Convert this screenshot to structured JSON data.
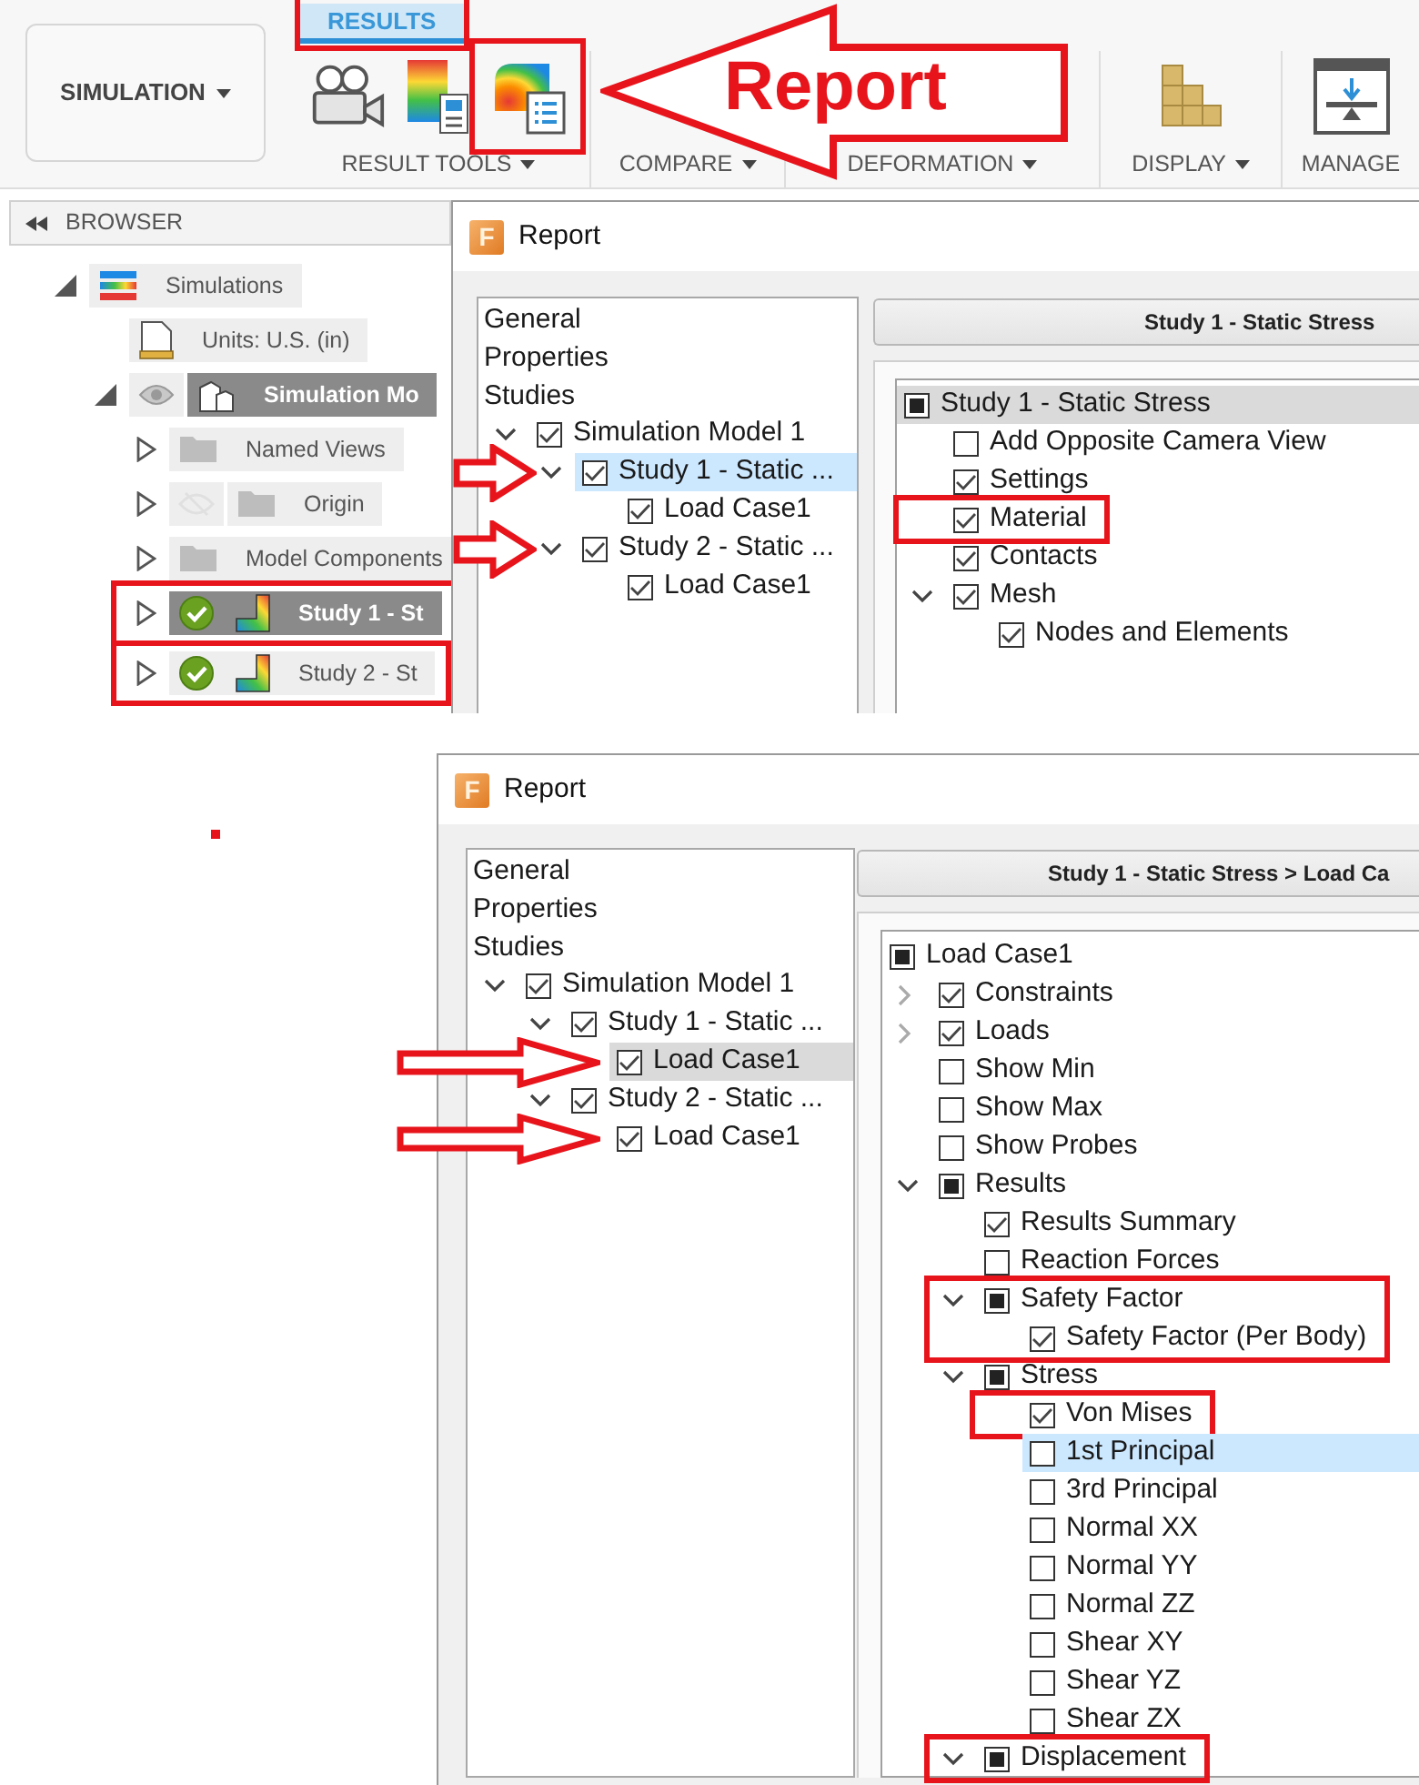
{
  "toolbar": {
    "workspace": {
      "label": "SIMULATION",
      "menu": true
    },
    "tabs": [
      {
        "label": "RESULTS",
        "selected": true,
        "outlined": true
      }
    ],
    "groups": [
      {
        "label": "RESULT TOOLS",
        "menu": true,
        "tools": [
          {
            "kind": "animate"
          },
          {
            "kind": "legend"
          },
          {
            "kind": "report",
            "outlined": true
          }
        ]
      },
      {
        "label": "COMPARE",
        "menu": true
      },
      {
        "label": "DEFORMATION",
        "menu": true
      },
      {
        "label": "DISPLAY",
        "menu": true,
        "tools": [
          {
            "kind": "display"
          }
        ]
      },
      {
        "label": "MANAGE",
        "tools": [
          {
            "kind": "manage"
          }
        ]
      }
    ]
  },
  "callout": {
    "text": "Report"
  },
  "browser": {
    "title": "BROWSER",
    "items": [
      {
        "kind": "simulations",
        "label": "Simulations",
        "expanded": true,
        "selected": false,
        "children": [
          {
            "kind": "units",
            "label": "Units: U.S. (in)",
            "selected": false
          },
          {
            "kind": "model",
            "label": "Simulation Mo",
            "expanded": true,
            "visible": true,
            "selected": true,
            "children": [
              {
                "kind": "folder",
                "label": "Named Views",
                "expanded": false,
                "selected": false
              },
              {
                "kind": "folder",
                "label": "Origin",
                "expanded": false,
                "visible": false,
                "selected": false
              },
              {
                "kind": "folder",
                "label": "Model Components",
                "expanded": false,
                "selected": false
              },
              {
                "kind": "study",
                "label": "Study 1 - St",
                "expanded": false,
                "solved": true,
                "selected": true,
                "outlined": true
              },
              {
                "kind": "study",
                "label": "Study 2 - St",
                "expanded": false,
                "solved": true,
                "selected": false,
                "outlined": true
              }
            ]
          }
        ]
      }
    ]
  },
  "report_windows": [
    {
      "title": "Report",
      "logo": "F",
      "studies_focused": true,
      "sections": [
        {
          "label": "General"
        },
        {
          "label": "Properties"
        },
        {
          "label": "Studies"
        }
      ],
      "study_tree": [
        {
          "label": "Simulation Model 1",
          "checked": true,
          "expanded": true,
          "selected": false,
          "children": [
            {
              "label": "Study 1 - Static ...",
              "checked": true,
              "expanded": true,
              "selected": true,
              "pointer": true,
              "children": [
                {
                  "label": "Load Case1",
                  "checked": true,
                  "selected": false
                }
              ]
            },
            {
              "label": "Study 2 - Static ...",
              "checked": true,
              "expanded": true,
              "selected": false,
              "pointer": true,
              "children": [
                {
                  "label": "Load Case1",
                  "checked": true,
                  "selected": false
                }
              ]
            }
          ]
        }
      ],
      "breadcrumb": "Study 1 - Static Stress",
      "options": [
        {
          "label": "Study 1 - Static Stress",
          "checked": false,
          "partial": true,
          "selected": true,
          "children": [
            {
              "label": "Add Opposite Camera View",
              "checked": false,
              "selected": false
            },
            {
              "label": "Settings",
              "checked": true,
              "selected": false
            },
            {
              "label": "Material",
              "checked": true,
              "selected": false,
              "outlined": true
            },
            {
              "label": "Contacts",
              "checked": true,
              "selected": false
            },
            {
              "label": "Mesh",
              "checked": true,
              "expanded": true,
              "selected": false,
              "children": [
                {
                  "label": "Nodes and Elements",
                  "checked": true,
                  "selected": false
                }
              ]
            }
          ]
        }
      ]
    },
    {
      "title": "Report",
      "logo": "F",
      "studies_focused": false,
      "sections": [
        {
          "label": "General"
        },
        {
          "label": "Properties"
        },
        {
          "label": "Studies"
        }
      ],
      "study_tree": [
        {
          "label": "Simulation Model 1",
          "checked": true,
          "expanded": true,
          "selected": false,
          "children": [
            {
              "label": "Study 1 - Static ...",
              "checked": true,
              "expanded": true,
              "selected": false,
              "children": [
                {
                  "label": "Load Case1",
                  "checked": true,
                  "selected": true,
                  "pointer": true
                }
              ]
            },
            {
              "label": "Study 2 - Static ...",
              "checked": true,
              "expanded": true,
              "selected": false,
              "children": [
                {
                  "label": "Load Case1",
                  "checked": true,
                  "selected": false,
                  "pointer": true
                }
              ]
            }
          ]
        }
      ],
      "breadcrumb": "Study 1 - Static Stress > Load Ca",
      "options": [
        {
          "label": "Load Case1",
          "checked": false,
          "partial": true,
          "selected": false,
          "children": [
            {
              "label": "Constraints",
              "checked": true,
              "expanded": false,
              "selected": false
            },
            {
              "label": "Loads",
              "checked": true,
              "expanded": false,
              "selected": false
            },
            {
              "label": "Show Min",
              "checked": false,
              "selected": false
            },
            {
              "label": "Show Max",
              "checked": false,
              "selected": false
            },
            {
              "label": "Show Probes",
              "checked": false,
              "selected": false
            },
            {
              "label": "Results",
              "checked": false,
              "partial": true,
              "expanded": true,
              "selected": false,
              "children": [
                {
                  "label": "Results Summary",
                  "checked": true,
                  "selected": false
                },
                {
                  "label": "Reaction Forces",
                  "checked": false,
                  "selected": false
                },
                {
                  "label": "Safety Factor",
                  "checked": false,
                  "partial": true,
                  "expanded": true,
                  "selected": false,
                  "outlined": true,
                  "children": [
                    {
                      "label": "Safety Factor (Per Body)",
                      "checked": true,
                      "selected": false
                    }
                  ]
                },
                {
                  "label": "Stress",
                  "checked": false,
                  "partial": true,
                  "expanded": true,
                  "selected": false,
                  "children": [
                    {
                      "label": "Von Mises",
                      "checked": true,
                      "selected": false,
                      "outlined": true
                    },
                    {
                      "label": "1st Principal",
                      "checked": false,
                      "selected": true
                    },
                    {
                      "label": "3rd Principal",
                      "checked": false,
                      "selected": false
                    },
                    {
                      "label": "Normal XX",
                      "checked": false,
                      "selected": false
                    },
                    {
                      "label": "Normal YY",
                      "checked": false,
                      "selected": false
                    },
                    {
                      "label": "Normal ZZ",
                      "checked": false,
                      "selected": false
                    },
                    {
                      "label": "Shear XY",
                      "checked": false,
                      "selected": false
                    },
                    {
                      "label": "Shear YZ",
                      "checked": false,
                      "selected": false
                    },
                    {
                      "label": "Shear ZX",
                      "checked": false,
                      "selected": false
                    }
                  ]
                },
                {
                  "label": "Displacement",
                  "checked": false,
                  "partial": true,
                  "expanded": true,
                  "selected": false,
                  "outlined": true
                }
              ]
            }
          ]
        }
      ]
    }
  ]
}
